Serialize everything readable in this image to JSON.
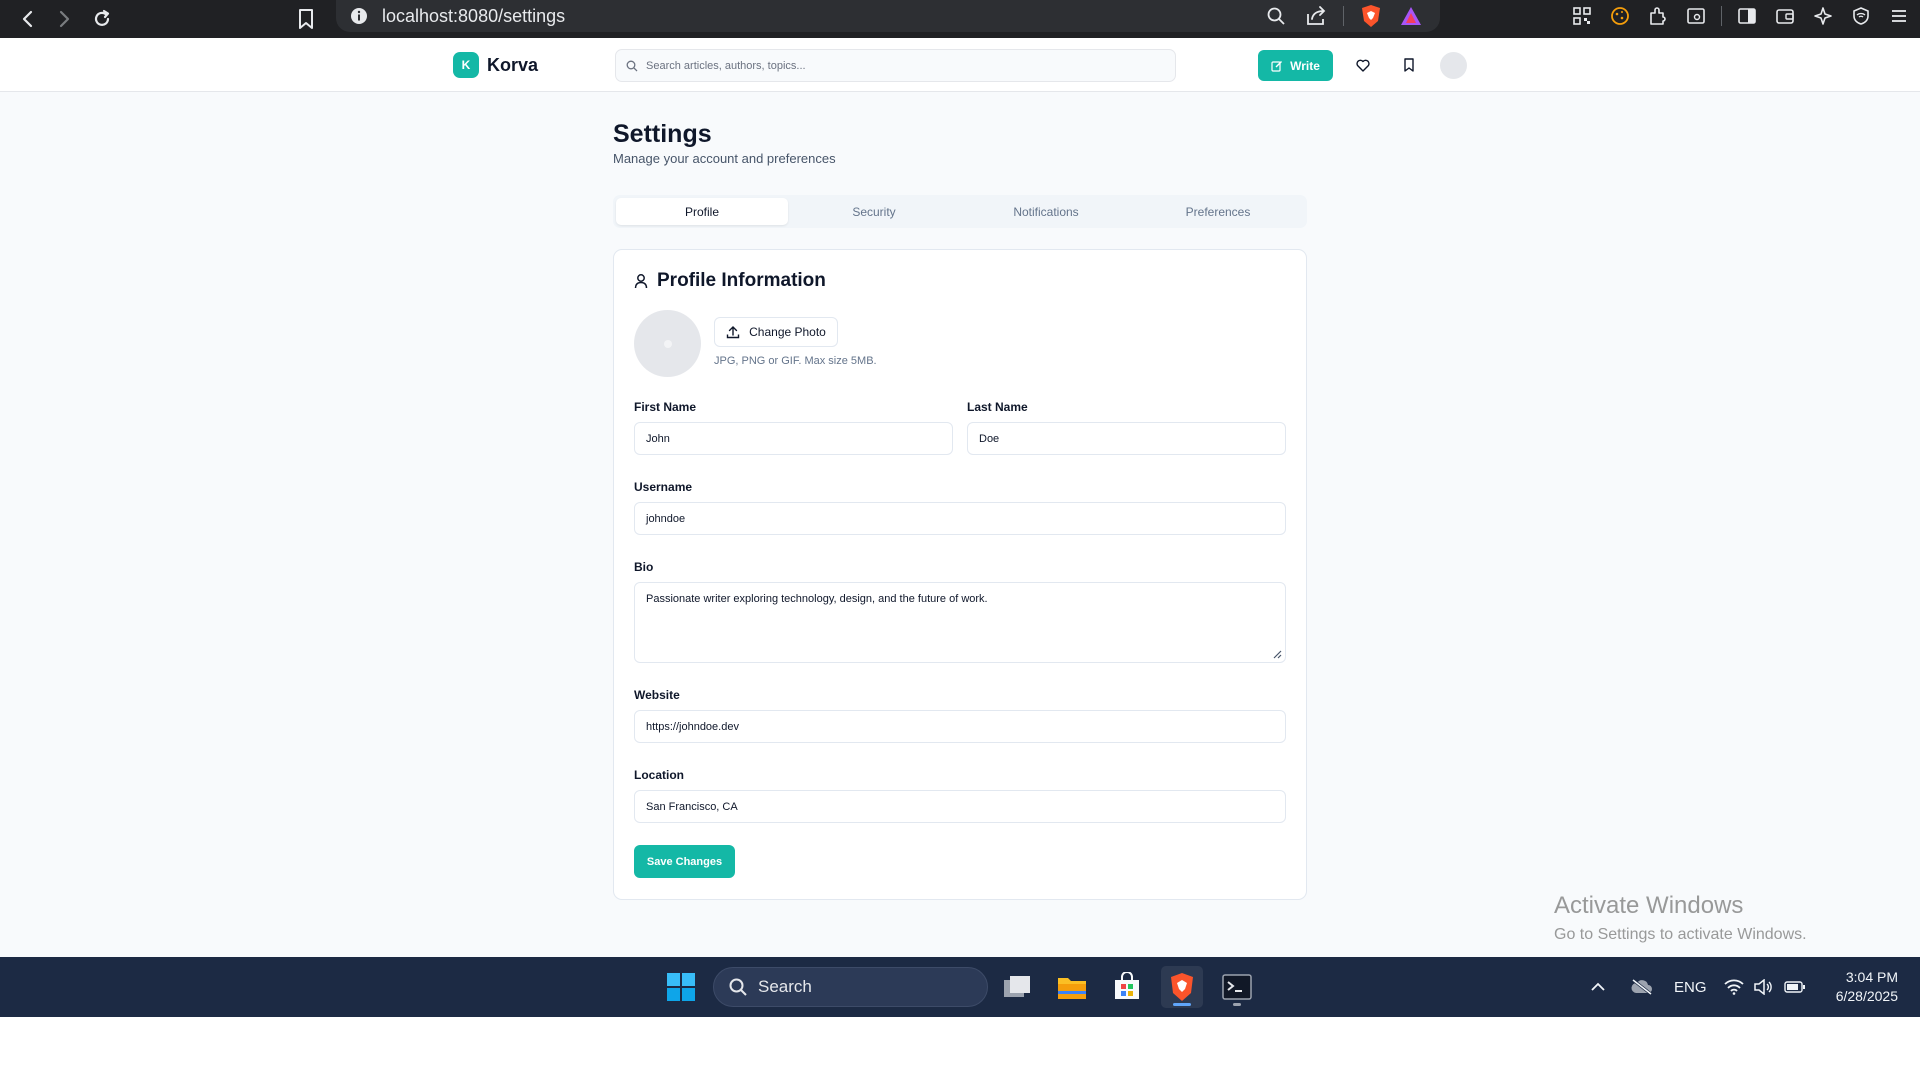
{
  "browser": {
    "url": "localhost:8080/settings"
  },
  "app": {
    "logo_letter": "K",
    "brand": "Korva",
    "search_placeholder": "Search articles, authors, topics...",
    "write_label": "Write"
  },
  "page": {
    "title": "Settings",
    "subtitle": "Manage your account and preferences"
  },
  "tabs": [
    {
      "label": "Profile",
      "active": true
    },
    {
      "label": "Security",
      "active": false
    },
    {
      "label": "Notifications",
      "active": false
    },
    {
      "label": "Preferences",
      "active": false
    }
  ],
  "profile": {
    "heading": "Profile Information",
    "change_photo_label": "Change Photo",
    "photo_hint": "JPG, PNG or GIF. Max size 5MB.",
    "first_name_label": "First Name",
    "first_name_value": "John",
    "last_name_label": "Last Name",
    "last_name_value": "Doe",
    "username_label": "Username",
    "username_value": "johndoe",
    "bio_label": "Bio",
    "bio_value": "Passionate writer exploring technology, design, and the future of work.",
    "website_label": "Website",
    "website_value": "https://johndoe.dev",
    "location_label": "Location",
    "location_value": "San Francisco, CA",
    "save_label": "Save Changes"
  },
  "watermark": {
    "title": "Activate Windows",
    "subtitle": "Go to Settings to activate Windows."
  },
  "taskbar": {
    "search_label": "Search",
    "language": "ENG",
    "time": "3:04 PM",
    "date": "6/28/2025"
  },
  "colors": {
    "accent": "#14b8a6",
    "page_bg": "#f8fafc",
    "taskbar_bg": "#1c2a44",
    "browser_bg": "#202124"
  }
}
